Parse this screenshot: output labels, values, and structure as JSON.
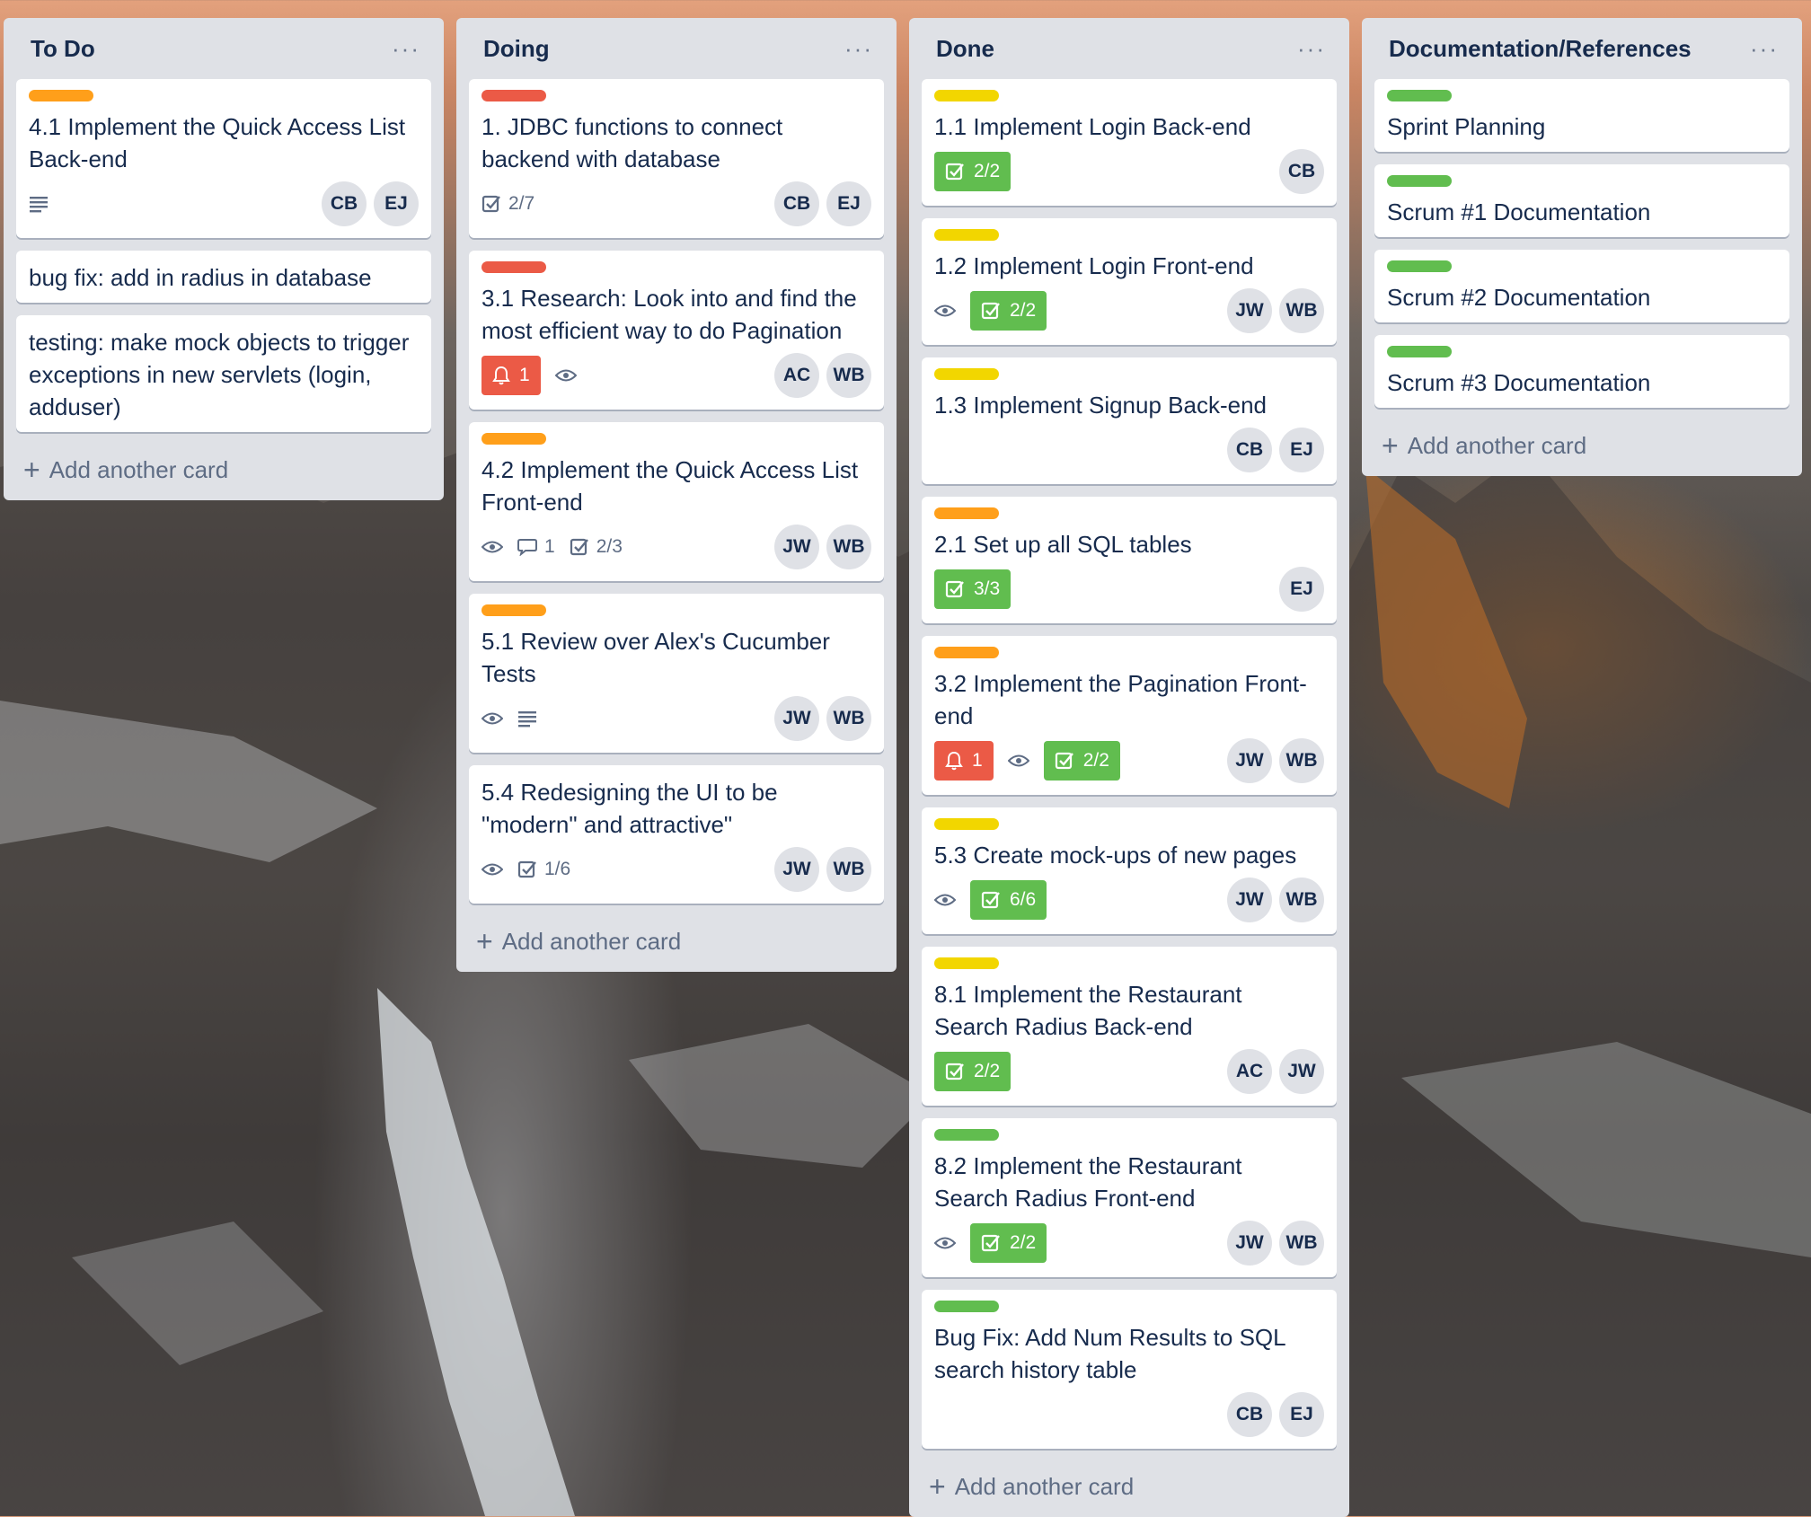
{
  "lists": [
    {
      "title": "To Do",
      "add_label": "Add another card",
      "cards": [
        {
          "title": "4.1 Implement the Quick Access List Back-end",
          "label_color": "#ff9f1a",
          "description": true,
          "members": [
            "CB",
            "EJ"
          ]
        },
        {
          "title": "bug fix: add in radius in database"
        },
        {
          "title": "testing: make mock objects to trigger exceptions in new servlets (login, adduser)"
        }
      ]
    },
    {
      "title": "Doing",
      "add_label": "Add another card",
      "cards": [
        {
          "title": "1. JDBC functions to connect backend with database",
          "label_color": "#eb5a46",
          "checklist": "2/7",
          "members": [
            "CB",
            "EJ"
          ]
        },
        {
          "title": "3.1 Research: Look into and find the most efficient way to do Pagination",
          "label_color": "#eb5a46",
          "due": "1",
          "watch": true,
          "members": [
            "AC",
            "WB"
          ]
        },
        {
          "title": "4.2 Implement the Quick Access List Front-end",
          "label_color": "#ff9f1a",
          "watch": true,
          "comments": "1",
          "checklist": "2/3",
          "members": [
            "JW",
            "WB"
          ]
        },
        {
          "title": "5.1 Review over Alex's Cucumber Tests",
          "label_color": "#ff9f1a",
          "watch": true,
          "description": true,
          "members": [
            "JW",
            "WB"
          ]
        },
        {
          "title": "5.4 Redesigning the UI to be \"modern\" and attractive\"",
          "watch": true,
          "checklist": "1/6",
          "members": [
            "JW",
            "WB"
          ]
        }
      ]
    },
    {
      "title": "Done",
      "add_label": "Add another card",
      "cards": [
        {
          "title": "1.1 Implement Login Back-end",
          "label_color": "#f2d600",
          "checklist_done": "2/2",
          "members": [
            "CB"
          ]
        },
        {
          "title": "1.2 Implement Login Front-end",
          "label_color": "#f2d600",
          "watch": true,
          "checklist_done": "2/2",
          "members": [
            "JW",
            "WB"
          ]
        },
        {
          "title": "1.3 Implement Signup Back-end",
          "label_color": "#f2d600",
          "members": [
            "CB",
            "EJ"
          ]
        },
        {
          "title": "2.1 Set up all SQL tables",
          "label_color": "#ff9f1a",
          "checklist_done": "3/3",
          "members": [
            "EJ"
          ]
        },
        {
          "title": "3.2 Implement the Pagination Front-end",
          "label_color": "#ff9f1a",
          "due": "1",
          "watch": true,
          "checklist_done": "2/2",
          "members": [
            "JW",
            "WB"
          ]
        },
        {
          "title": "5.3 Create mock-ups of new pages",
          "label_color": "#f2d600",
          "watch": true,
          "checklist_done": "6/6",
          "members": [
            "JW",
            "WB"
          ]
        },
        {
          "title": "8.1 Implement the Restaurant Search Radius Back-end",
          "label_color": "#f2d600",
          "checklist_done": "2/2",
          "members": [
            "AC",
            "JW"
          ]
        },
        {
          "title": "8.2 Implement the Restaurant Search Radius Front-end",
          "label_color": "#61bd4f",
          "watch": true,
          "checklist_done": "2/2",
          "members": [
            "JW",
            "WB"
          ]
        },
        {
          "title": "Bug Fix: Add Num Results to SQL search history table",
          "label_color": "#61bd4f",
          "members": [
            "CB",
            "EJ"
          ]
        }
      ]
    },
    {
      "title": "Documentation/References",
      "add_label": "Add another card",
      "cards": [
        {
          "title": "Sprint Planning",
          "label_color": "#61bd4f"
        },
        {
          "title": "Scrum #1 Documentation",
          "label_color": "#61bd4f"
        },
        {
          "title": "Scrum #2 Documentation",
          "label_color": "#61bd4f"
        },
        {
          "title": "Scrum #3 Documentation",
          "label_color": "#61bd4f"
        }
      ]
    }
  ]
}
